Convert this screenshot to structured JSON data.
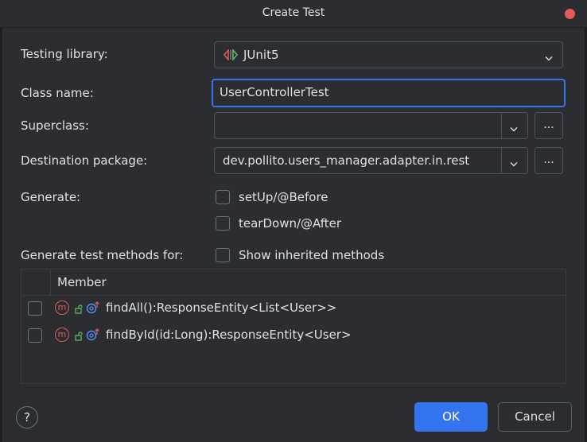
{
  "window": {
    "title": "Create Test"
  },
  "form": {
    "testing_library": {
      "label": "Testing library:",
      "value": "JUnit5"
    },
    "class_name": {
      "label": "Class name:",
      "value": "UserControllerTest"
    },
    "superclass": {
      "label": "Superclass:",
      "value": "",
      "browse_label": "..."
    },
    "destination_package": {
      "label": "Destination package:",
      "value": "dev.pollito.users_manager.adapter.in.rest",
      "browse_label": "..."
    },
    "generate": {
      "label": "Generate:",
      "options": [
        {
          "label": "setUp/@Before",
          "checked": false
        },
        {
          "label": "tearDown/@After",
          "checked": false
        }
      ]
    },
    "generate_methods": {
      "label": "Generate test methods for:",
      "show_inherited_label": "Show inherited methods",
      "show_inherited_checked": false
    }
  },
  "table": {
    "column_header": "Member",
    "rows": [
      {
        "text": "findAll():ResponseEntity<List<User>>",
        "checked": false
      },
      {
        "text": "findById(id:Long):ResponseEntity<User>",
        "checked": false
      }
    ]
  },
  "footer": {
    "help_label": "?",
    "ok_label": "OK",
    "cancel_label": "Cancel"
  },
  "colors": {
    "accent": "#3574f0",
    "method_icon": "#db5c5c",
    "lock_icon": "#5fb865",
    "override_icon": "#548af7",
    "close": "#e55b57"
  },
  "icons": {
    "library": "junit-icon",
    "method": "method-icon",
    "visibility": "public-lock-icon",
    "override": "implements-icon"
  }
}
